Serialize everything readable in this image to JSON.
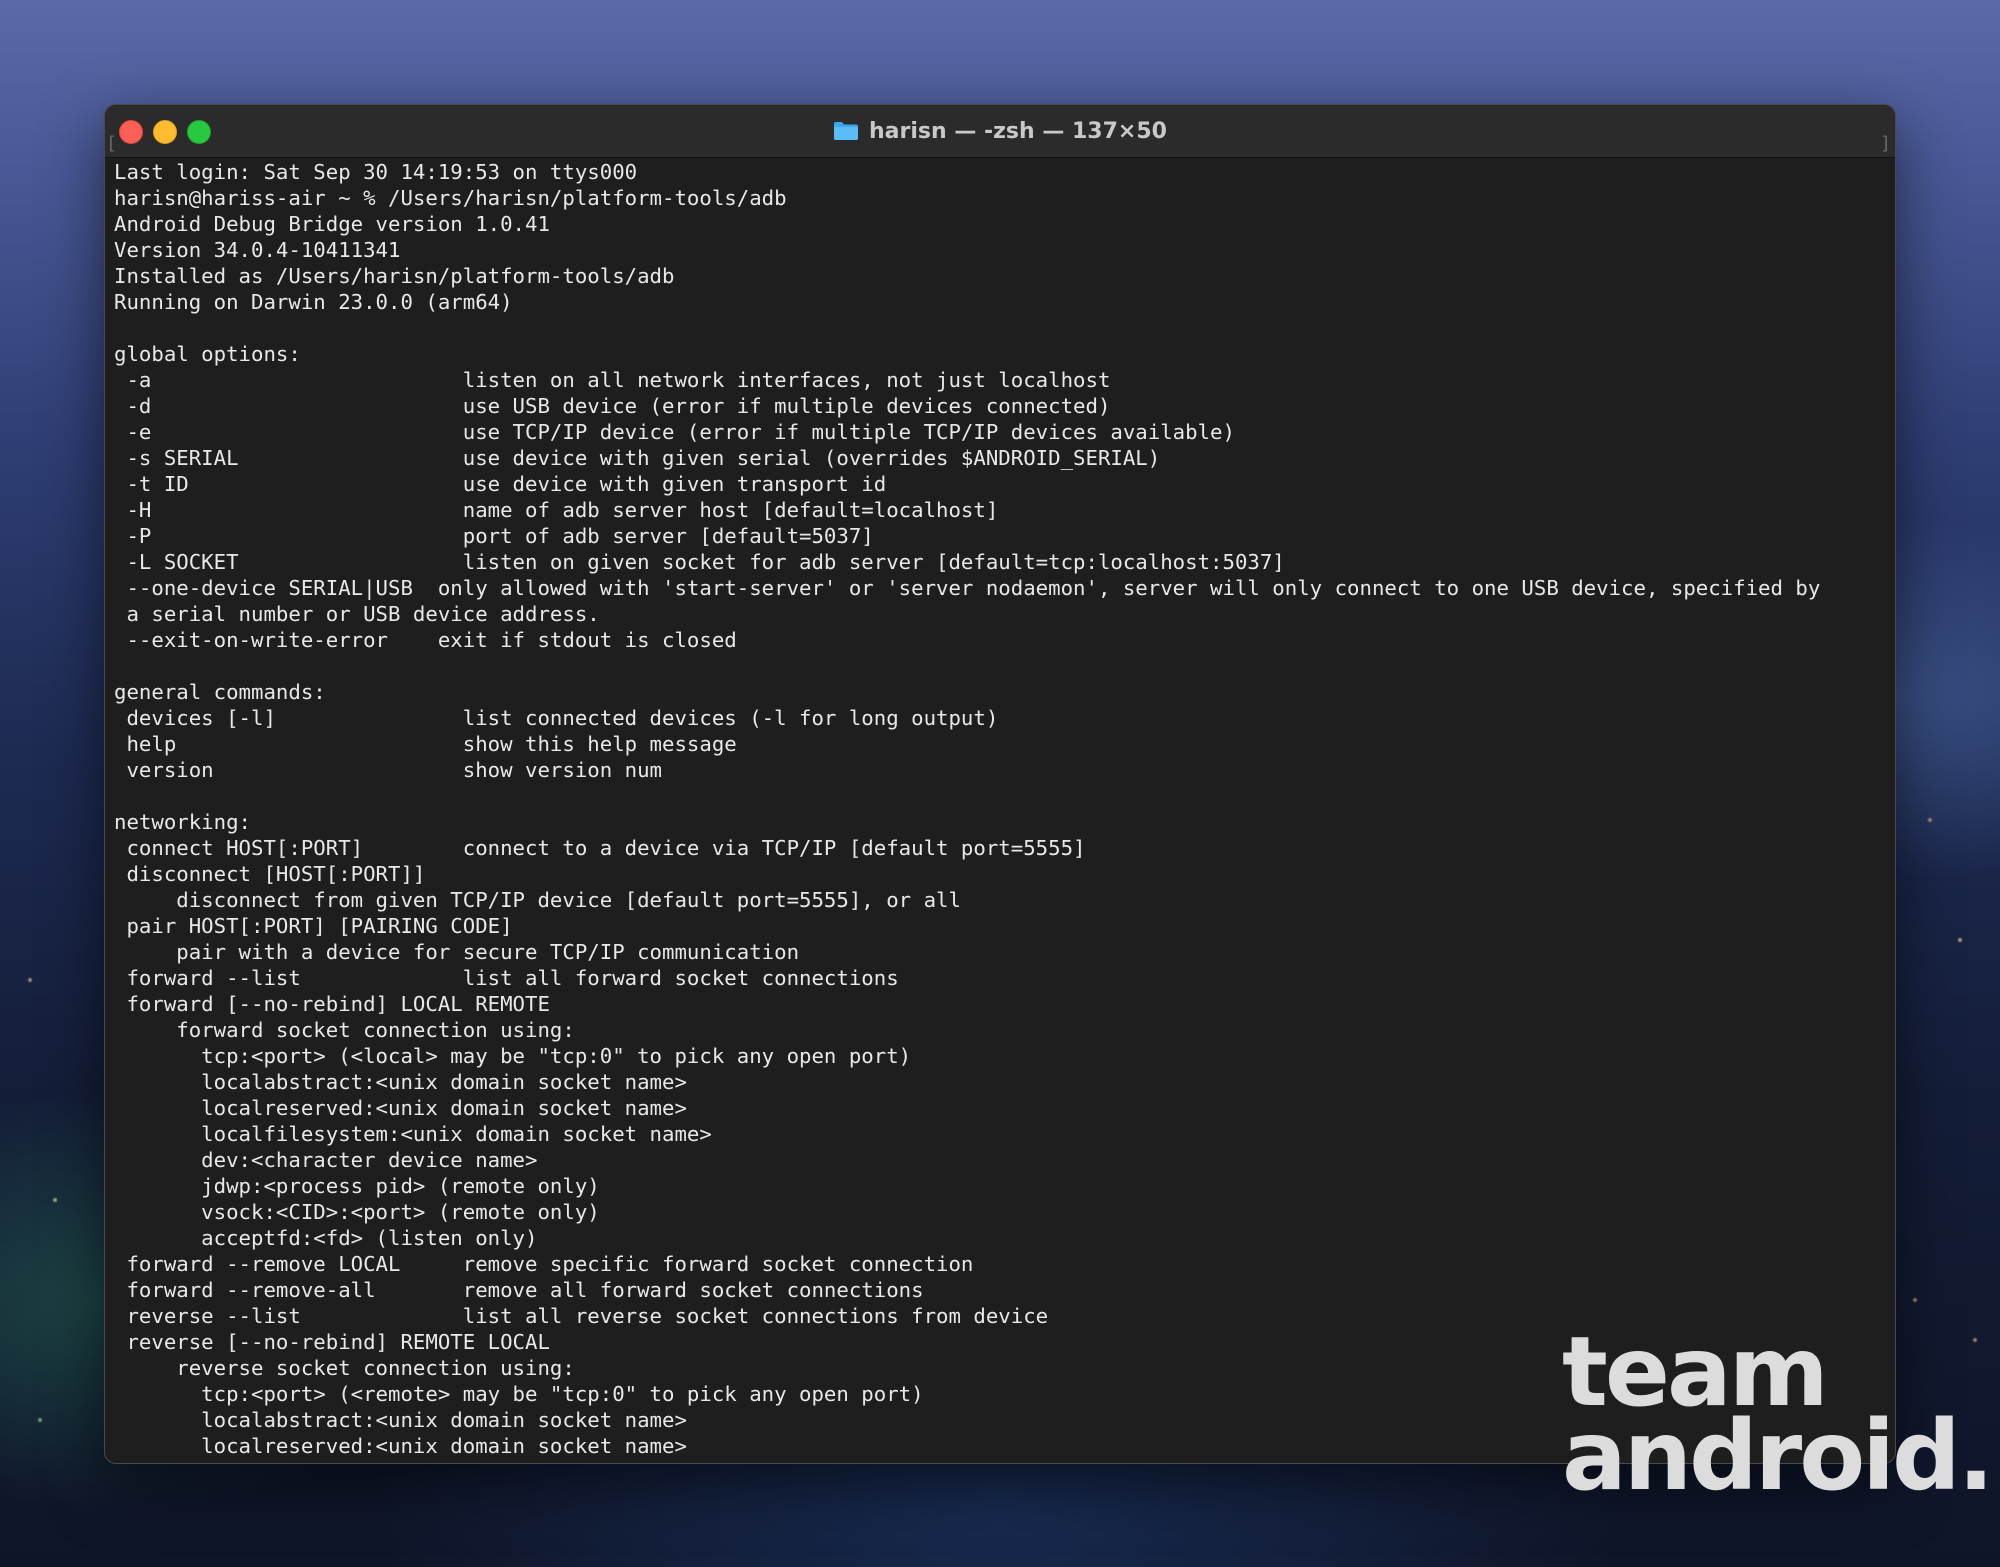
{
  "window": {
    "title": "harisn — -zsh — 137×50",
    "title_icon": "folder-icon",
    "colors": {
      "close": "#fe5f57",
      "minimize": "#febc2e",
      "zoom": "#28c840",
      "background": "#1e1e1e",
      "text": "#e8e8e8"
    }
  },
  "terminal": {
    "lines": [
      "Last login: Sat Sep 30 14:19:53 on ttys000",
      "harisn@hariss-air ~ % /Users/harisn/platform-tools/adb",
      "Android Debug Bridge version 1.0.41",
      "Version 34.0.4-10411341",
      "Installed as /Users/harisn/platform-tools/adb",
      "Running on Darwin 23.0.0 (arm64)",
      "",
      "global options:",
      " -a                         listen on all network interfaces, not just localhost",
      " -d                         use USB device (error if multiple devices connected)",
      " -e                         use TCP/IP device (error if multiple TCP/IP devices available)",
      " -s SERIAL                  use device with given serial (overrides $ANDROID_SERIAL)",
      " -t ID                      use device with given transport id",
      " -H                         name of adb server host [default=localhost]",
      " -P                         port of adb server [default=5037]",
      " -L SOCKET                  listen on given socket for adb server [default=tcp:localhost:5037]",
      " --one-device SERIAL|USB  only allowed with 'start-server' or 'server nodaemon', server will only connect to one USB device, specified by",
      " a serial number or USB device address.",
      " --exit-on-write-error    exit if stdout is closed",
      "",
      "general commands:",
      " devices [-l]               list connected devices (-l for long output)",
      " help                       show this help message",
      " version                    show version num",
      "",
      "networking:",
      " connect HOST[:PORT]        connect to a device via TCP/IP [default port=5555]",
      " disconnect [HOST[:PORT]]",
      "     disconnect from given TCP/IP device [default port=5555], or all",
      " pair HOST[:PORT] [PAIRING CODE]",
      "     pair with a device for secure TCP/IP communication",
      " forward --list             list all forward socket connections",
      " forward [--no-rebind] LOCAL REMOTE",
      "     forward socket connection using:",
      "       tcp:<port> (<local> may be \"tcp:0\" to pick any open port)",
      "       localabstract:<unix domain socket name>",
      "       localreserved:<unix domain socket name>",
      "       localfilesystem:<unix domain socket name>",
      "       dev:<character device name>",
      "       jdwp:<process pid> (remote only)",
      "       vsock:<CID>:<port> (remote only)",
      "       acceptfd:<fd> (listen only)",
      " forward --remove LOCAL     remove specific forward socket connection",
      " forward --remove-all       remove all forward socket connections",
      " reverse --list             list all reverse socket connections from device",
      " reverse [--no-rebind] REMOTE LOCAL",
      "     reverse socket connection using:",
      "       tcp:<port> (<remote> may be \"tcp:0\" to pick any open port)",
      "       localabstract:<unix domain socket name>",
      "       localreserved:<unix domain socket name>"
    ]
  },
  "watermark": {
    "line1": "team",
    "line2": "android."
  }
}
